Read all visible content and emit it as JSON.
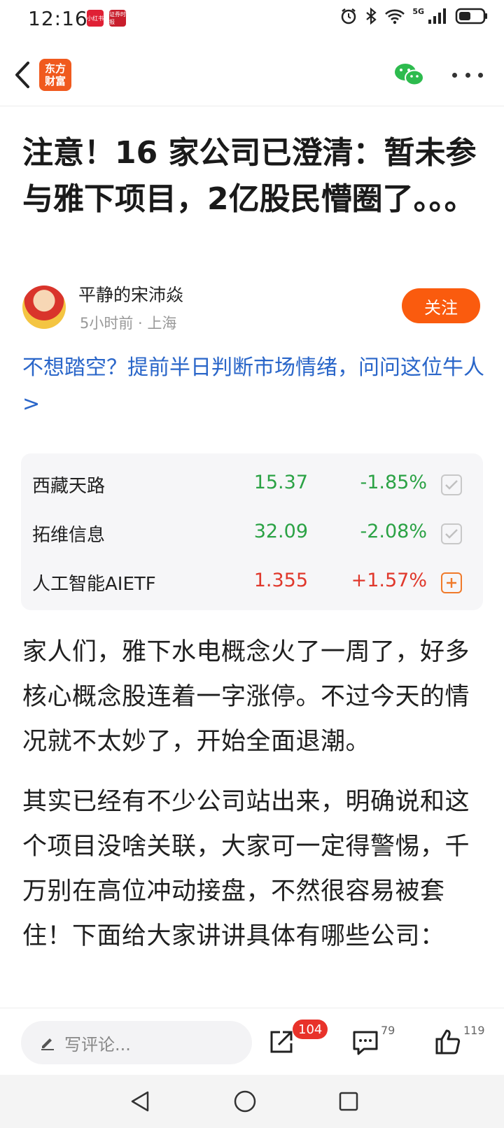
{
  "status_bar": {
    "time": "12:16",
    "network": "5G",
    "app_badges": [
      "小红书",
      "证券时报"
    ]
  },
  "nav": {
    "logo_line1": "东方",
    "logo_line2": "财富",
    "icons": [
      "back-icon",
      "wechat-icon",
      "more-icon"
    ]
  },
  "article": {
    "title": "注意！16 家公司已澄清：暂未参与雅下项目，2亿股民懵圈了。。。",
    "author": {
      "name": "平静的宋沛焱",
      "meta": "5小时前 · 上海",
      "follow_label": "关注"
    },
    "promo_text": "不想踏空？提前半日判断市场情绪，问问这位牛人>",
    "paragraphs": [
      "家人们，雅下水电概念火了一周了，好多核心概念股连着一字涨停。不过今天的情况就不太妙了，开始全面退潮。",
      "其实已经有不少公司站出来，明确说和这个项目没啥关联，大家可一定得警惕，千万别在高位冲动接盘，不然很容易被套住！下面给大家讲讲具体有哪些公司："
    ]
  },
  "stocks": [
    {
      "name": "西藏天路",
      "price": "15.37",
      "change": "-1.85%",
      "direction": "down",
      "state": "added"
    },
    {
      "name": "拓维信息",
      "price": "32.09",
      "change": "-2.08%",
      "direction": "down",
      "state": "added"
    },
    {
      "name": "人工智能AIETF",
      "price": "1.355",
      "change": "+1.57%",
      "direction": "up",
      "state": "add"
    }
  ],
  "action_bar": {
    "comment_placeholder": "写评论...",
    "share_count": "104",
    "comment_count": "79",
    "like_count": "119"
  },
  "colors": {
    "accent": "#fa5b0e",
    "link": "#2a66c9",
    "down": "#2ba245",
    "up": "#e0382c"
  }
}
